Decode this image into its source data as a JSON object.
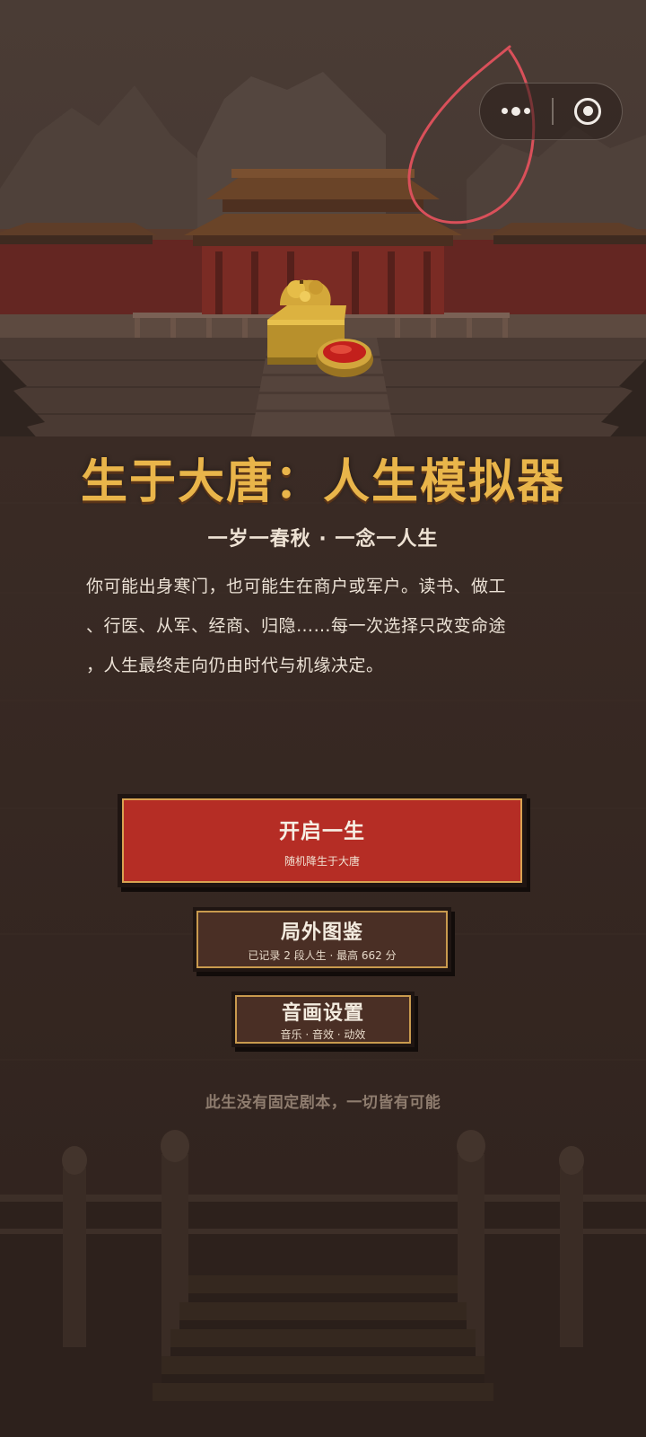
{
  "game": {
    "title": "生于大唐：人生模拟器",
    "subtitle": "一岁一春秋 · 一念一人生",
    "intro_lines": [
      "你可能出身寒门，也可能生在商户或军户。读书、做工",
      "、行医、从军、经商、归隐……每一次选择只改变命途",
      "，人生最终走向仍由时代与机缘决定。"
    ],
    "tagline": "此生没有固定剧本，一切皆有可能"
  },
  "menu": {
    "start": {
      "label": "开启一生",
      "sub": "随机降生于大唐"
    },
    "codex": {
      "label": "局外图鉴",
      "sub": "已记录 2 段人生 · 最高 662 分"
    },
    "settings": {
      "label": "音画设置",
      "sub": "音乐 · 音效 · 动效"
    }
  },
  "capsule": {
    "more_icon": "more-dots-icon",
    "close_icon": "target-circle-icon"
  },
  "colors": {
    "background": "#3a2c26",
    "title_gold": "#e9b54a",
    "primary_red": "#b52d25",
    "button_brown": "#4a2f25",
    "border_gold": "#c99a4e",
    "annotation_red": "#d9505a"
  }
}
